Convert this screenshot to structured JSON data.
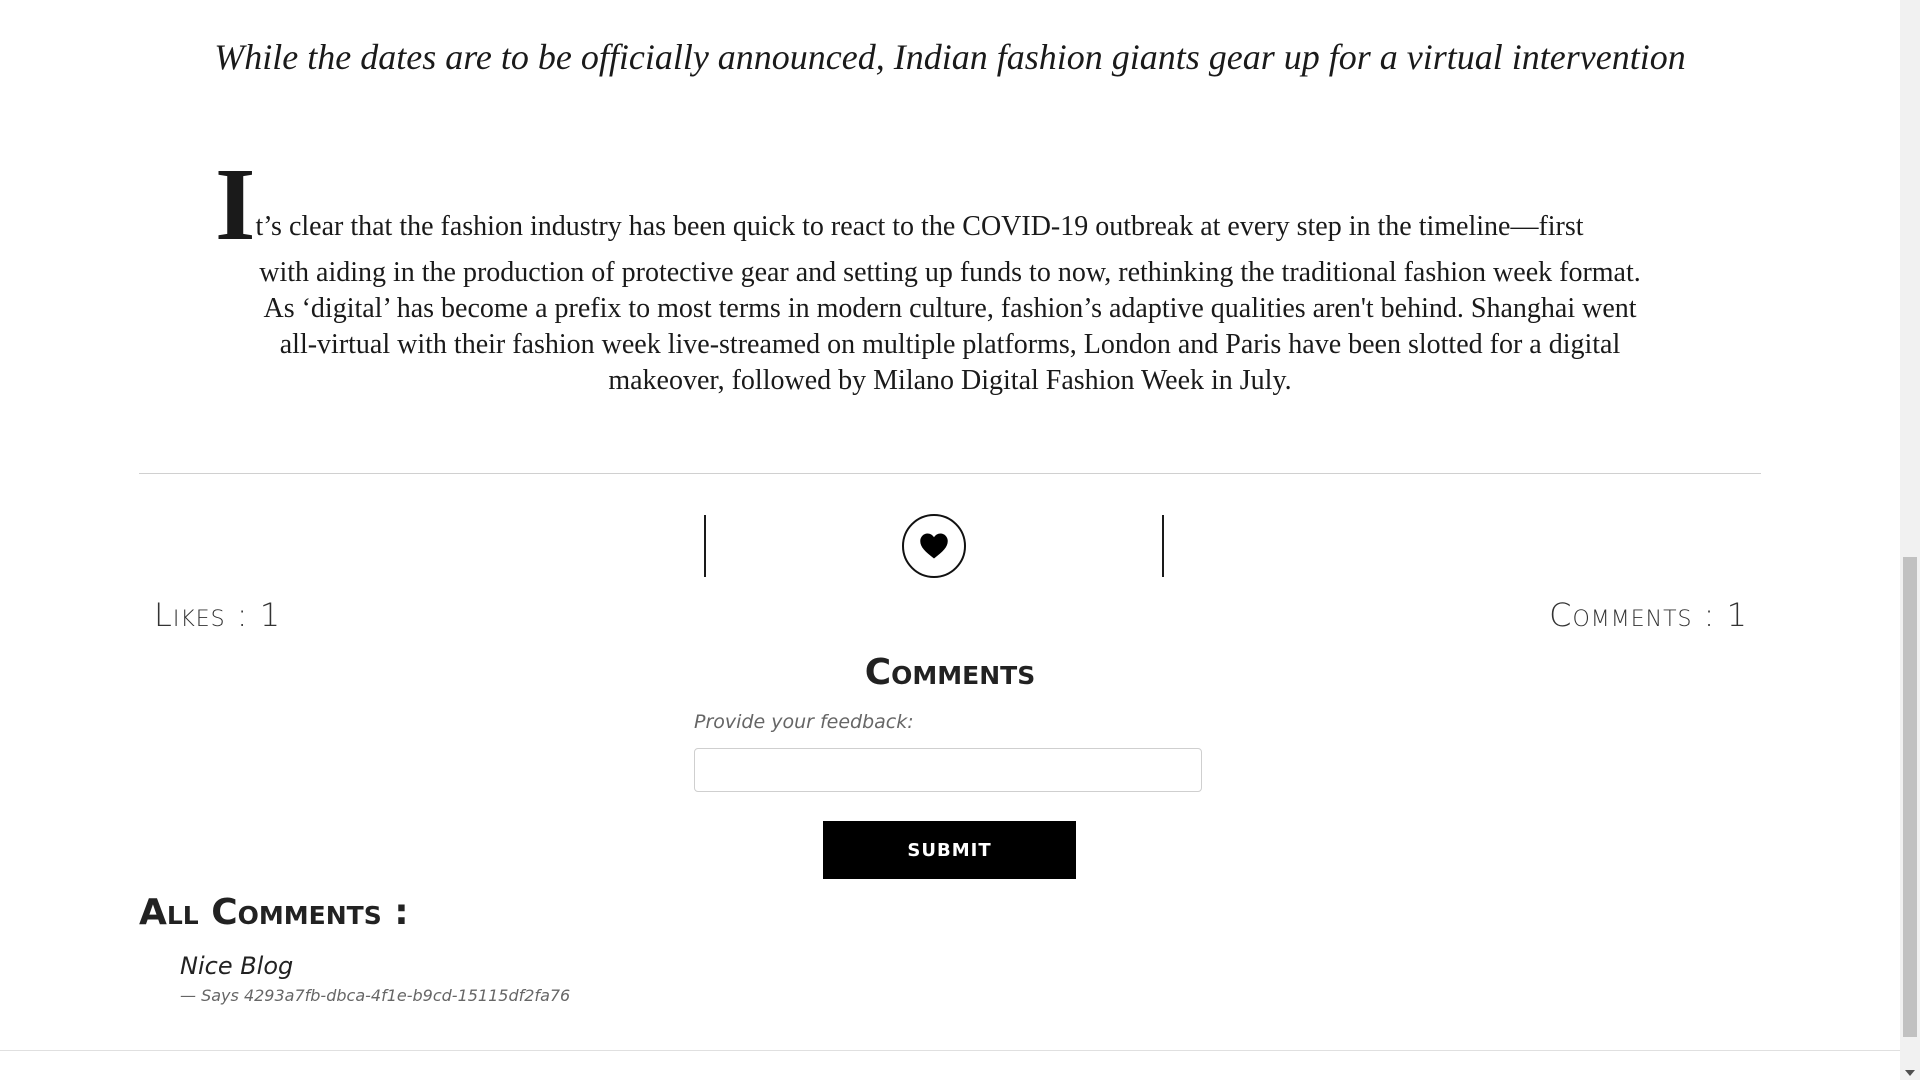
{
  "article": {
    "subtitle": "While the dates are to be officially announced, Indian fashion giants gear up for a virtual intervention",
    "dropcap": "I",
    "first_line_rest": "t’s clear that the fashion industry has been quick to react to the COVID-19 outbreak at every step in the timeline—first",
    "body_rest": "with aiding in the production of protective gear and setting up funds to now, rethinking the traditional fashion week format. As ‘digital’ has become a prefix to most terms in modern culture, fashion’s adaptive qualities aren't behind. Shanghai went all-virtual with their fashion week live-streamed on multiple platforms, London and Paris have been slotted for a digital makeover, followed by Milano Digital Fashion Week in July."
  },
  "stats": {
    "likes": "Likes : 1",
    "comments": "Comments : 1"
  },
  "comment_form": {
    "heading": "Comments",
    "label": "Provide your feedback:",
    "input_value": "",
    "submit_label": "SUBMIT"
  },
  "all_comments": {
    "heading": "All Comments :",
    "items": [
      {
        "text": "Nice Blog",
        "author_line": "— Says 4293a7fb-dbca-4f1e-b9cd-15115df2fa76"
      }
    ]
  },
  "icons": {
    "like": "heart-icon"
  },
  "colors": {
    "submit_bg": "#000000",
    "text": "#1a1a1a"
  }
}
